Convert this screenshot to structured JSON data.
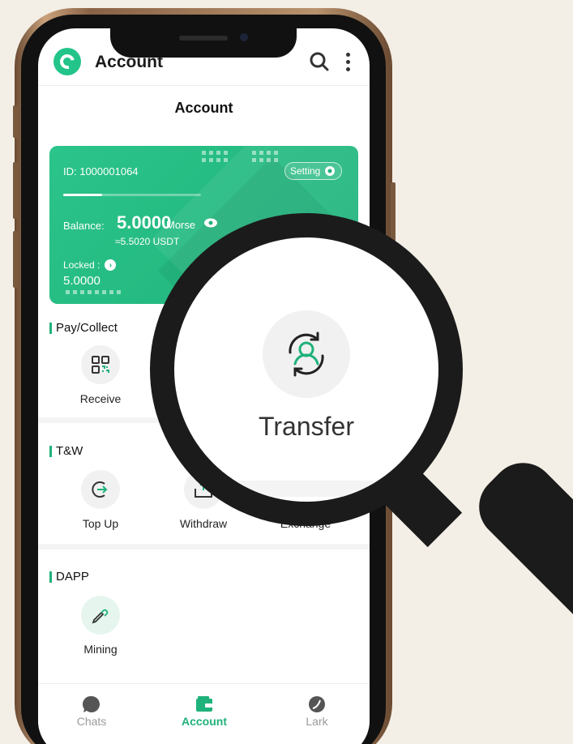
{
  "app_bar": {
    "title": "Account"
  },
  "page": {
    "title": "Account"
  },
  "card": {
    "id_text": "ID:  1000001064",
    "setting_label": "Setting",
    "balance_label": "Balance:",
    "balance_value": "5.0000",
    "balance_unit": "Morse",
    "usdt_value": "≈5.5020 USDT",
    "locked_label": "Locked :",
    "locked_value": "5.0000"
  },
  "sections": {
    "pay_collect": {
      "title": "Pay/Collect",
      "items": [
        {
          "label": "Receive",
          "icon": "qr-code-icon"
        }
      ]
    },
    "tw": {
      "title": "T&W",
      "items": [
        {
          "label": "Top Up",
          "icon": "top-up-icon"
        },
        {
          "label": "Withdraw",
          "icon": "withdraw-icon"
        },
        {
          "label": "Exchange",
          "icon": "exchange-icon"
        }
      ]
    },
    "dapp": {
      "title": "DAPP",
      "items": [
        {
          "label": "Mining",
          "icon": "mining-icon"
        }
      ]
    }
  },
  "tabs": [
    {
      "label": "Chats",
      "icon": "chat-bubble-icon",
      "active": false
    },
    {
      "label": "Account",
      "icon": "wallet-icon",
      "active": true
    },
    {
      "label": "Lark",
      "icon": "lark-icon",
      "active": false
    }
  ],
  "magnifier": {
    "label": "Transfer",
    "icon": "transfer-user-icon"
  },
  "colors": {
    "accent": "#1fb27a",
    "background": "#f3efe6"
  }
}
